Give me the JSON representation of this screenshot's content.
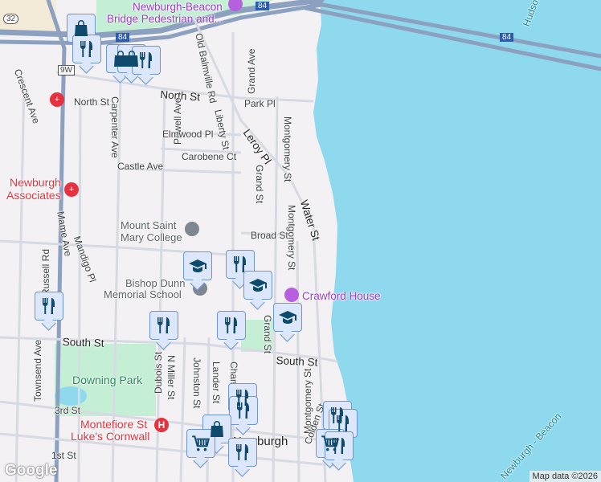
{
  "labels": {
    "bridge_pedestrian": "Newburgh-Beacon",
    "bridge_pedestrian2": "Bridge Pedestrian and...",
    "hudson": "Hudson",
    "route_32": "32",
    "route_9w": "9W",
    "i84_a": "84",
    "i84_b": "84",
    "i84_c": "84",
    "crescent_ave": "Crescent Ave",
    "north_st_w": "North St",
    "north_st": "North St",
    "carpenter_ave": "Carpenter Ave",
    "powell_ave": "Powell Ave",
    "old_balmville": "Old Balmville Rd",
    "grand_ave": "Grand Ave",
    "park_pl": "Park Pl",
    "liberty_st": "Liberty St",
    "elmwood_pl": "Elmwood Pl",
    "leroy_pl": "Leroy Pl",
    "carobene_ct": "Carobene Ct",
    "montgomery_st_n": "Montgomery St",
    "castle_ave": "Castle Ave",
    "grand_st_n": "Grand St",
    "newburgh_assoc1": "Newburgh",
    "newburgh_assoc2": "Associates",
    "water_st": "Water St",
    "mount_saint_mary1": "Mount Saint",
    "mount_saint_mary2": "Mary College",
    "mame_ave": "Mame Ave",
    "mandigo_pl": "Mandigo Pl",
    "broad_st": "Broad St",
    "montgomery_st_m": "Montgomery St",
    "russell_rd": "Russell Rd",
    "bishop_dunn1": "Bishop Dunn",
    "bishop_dunn2": "Memorial School",
    "crawford_house": "Crawford House",
    "south_st_w": "South St",
    "south_st_e": "South St",
    "grand_st_s": "Grand St",
    "townsend_ave": "Townsend Ave",
    "downing_park": "Downing Park",
    "dubois_st": "Dubois St",
    "n_miller_st": "N Miller St",
    "johnston_st": "Johnston St",
    "lander_st": "Lander St",
    "chambers_st": "Chambers St",
    "montgomery_st_s": "Montgomery St",
    "colden_st": "Colden St",
    "third_st": "3rd St",
    "montefiore1": "Montefiore St",
    "montefiore2": "Luke's Cornwall",
    "newburgh_city": "Newburgh",
    "first_st": "1st St",
    "ferry": "Newburgh - Beacon"
  },
  "attribution": "Map data ©2026",
  "google_logo": "Google",
  "colors": {
    "water": "#8fd9ee",
    "land": "#f3f1f4",
    "park": "#c4efd4",
    "marker_bg": "#dce7fb",
    "marker_border": "#6d95d8",
    "marker_icon": "#0d4a6b"
  },
  "markers": [
    {
      "type": "shopping"
    },
    {
      "type": "restaurant"
    },
    {
      "type": "shopping"
    },
    {
      "type": "shopping"
    },
    {
      "type": "restaurant"
    },
    {
      "type": "school"
    },
    {
      "type": "restaurant"
    },
    {
      "type": "school"
    },
    {
      "type": "school"
    },
    {
      "type": "restaurant"
    },
    {
      "type": "restaurant"
    },
    {
      "type": "restaurant"
    },
    {
      "type": "restaurant"
    },
    {
      "type": "restaurant"
    },
    {
      "type": "shopping"
    },
    {
      "type": "grocery"
    },
    {
      "type": "restaurant"
    },
    {
      "type": "restaurant"
    },
    {
      "type": "restaurant"
    },
    {
      "type": "grocery"
    },
    {
      "type": "restaurant"
    }
  ]
}
